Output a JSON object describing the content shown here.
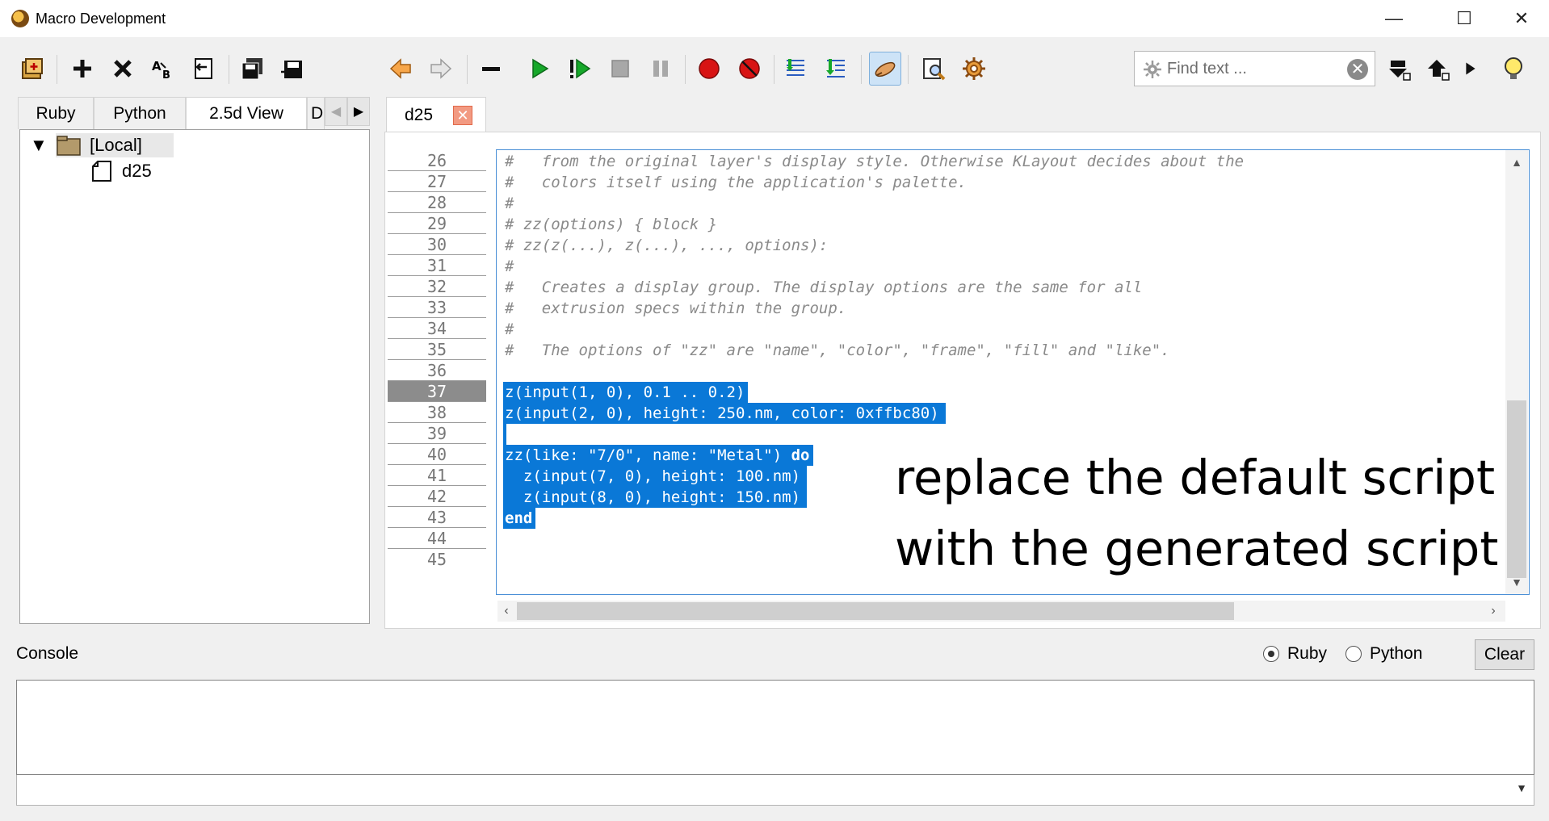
{
  "window": {
    "title": "Macro Development",
    "minimize": "—",
    "maximize": "☐",
    "close": "✕"
  },
  "toolbar": {
    "icons": [
      "new-folder-icon",
      "add-icon",
      "delete-icon",
      "rename-icon",
      "import-icon",
      "save-all-icon",
      "save-icon",
      "back-icon",
      "forward-icon",
      "remove-line-icon",
      "run-icon",
      "run-from-icon",
      "stop-icon",
      "pause-icon",
      "breakpoint-icon",
      "clear-breakpoints-icon",
      "step-into-icon",
      "step-over-icon",
      "eraser-icon",
      "search-icon",
      "settings-icon"
    ],
    "find_placeholder": "Find text ...",
    "find_clear": "✕"
  },
  "left_panel": {
    "tabs": [
      "Ruby",
      "Python",
      "2.5d View",
      "D"
    ],
    "active_tab": "2.5d View",
    "tree": {
      "root": "[Local]",
      "child": "d25"
    }
  },
  "editor": {
    "tab": {
      "label": "d25",
      "close": "✕"
    },
    "current_line": 37,
    "lines": [
      {
        "n": "26",
        "text": "#   from the original layer's display style. Otherwise KLayout decides about the",
        "kind": "comment"
      },
      {
        "n": "27",
        "text": "#   colors itself using the application's palette.",
        "kind": "comment"
      },
      {
        "n": "28",
        "text": "#",
        "kind": "comment"
      },
      {
        "n": "29",
        "text": "# zz(options) { block }",
        "kind": "comment"
      },
      {
        "n": "30",
        "text": "# zz(z(...), z(...), ..., options):",
        "kind": "comment"
      },
      {
        "n": "31",
        "text": "#",
        "kind": "comment"
      },
      {
        "n": "32",
        "text": "#   Creates a display group. The display options are the same for all",
        "kind": "comment"
      },
      {
        "n": "33",
        "text": "#   extrusion specs within the group.",
        "kind": "comment"
      },
      {
        "n": "34",
        "text": "#",
        "kind": "comment"
      },
      {
        "n": "35",
        "text": "#   The options of \"zz\" are \"name\", \"color\", \"frame\", \"fill\" and \"like\".",
        "kind": "comment"
      },
      {
        "n": "36",
        "text": "",
        "kind": "plain"
      },
      {
        "n": "37",
        "text": "z(input(1, 0), 0.1 .. 0.2)",
        "kind": "hl"
      },
      {
        "n": "38",
        "text": "z(input(2, 0), height: 250.nm, color: 0xffbc80)",
        "kind": "hl"
      },
      {
        "n": "39",
        "text": " ",
        "kind": "hl"
      },
      {
        "n": "40",
        "text": "zz(like: \"7/0\", name: \"Metal\") ",
        "kw": "do",
        "kind": "hl"
      },
      {
        "n": "41",
        "text": "  z(input(7, 0), height: 100.nm)",
        "kind": "hl"
      },
      {
        "n": "42",
        "text": "  z(input(8, 0), height: 150.nm)",
        "kind": "hl"
      },
      {
        "n": "43",
        "text": "",
        "kw": "end",
        "kind": "hl"
      },
      {
        "n": "44",
        "text": "",
        "kind": "plain"
      },
      {
        "n": "45",
        "text": "",
        "kind": "plain"
      }
    ],
    "annotation": [
      "replace the default script",
      "with the generated script"
    ]
  },
  "console": {
    "label": "Console",
    "languages": [
      "Ruby",
      "Python"
    ],
    "selected_language": "Ruby",
    "clear_label": "Clear"
  }
}
